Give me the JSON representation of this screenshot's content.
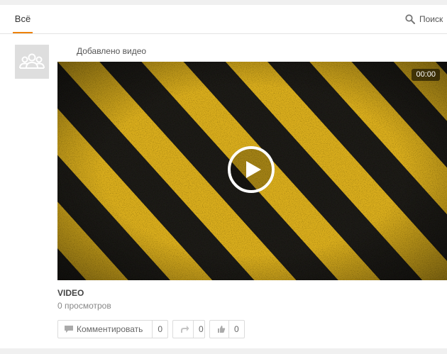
{
  "tabs": {
    "all_label": "Всё"
  },
  "search": {
    "label": "Поиск",
    "icon": "search-icon"
  },
  "post": {
    "title": "Добавлено видео",
    "video": {
      "duration": "00:00",
      "name": "VIDEO",
      "views": "0 просмотров"
    },
    "actions": {
      "comment_label": "Комментировать",
      "comment_count": "0",
      "share_count": "0",
      "like_count": "0"
    }
  },
  "colors": {
    "accent": "#ee8208",
    "stripe_yellow": "#d9ad1c",
    "stripe_dark": "#1c1a15"
  }
}
